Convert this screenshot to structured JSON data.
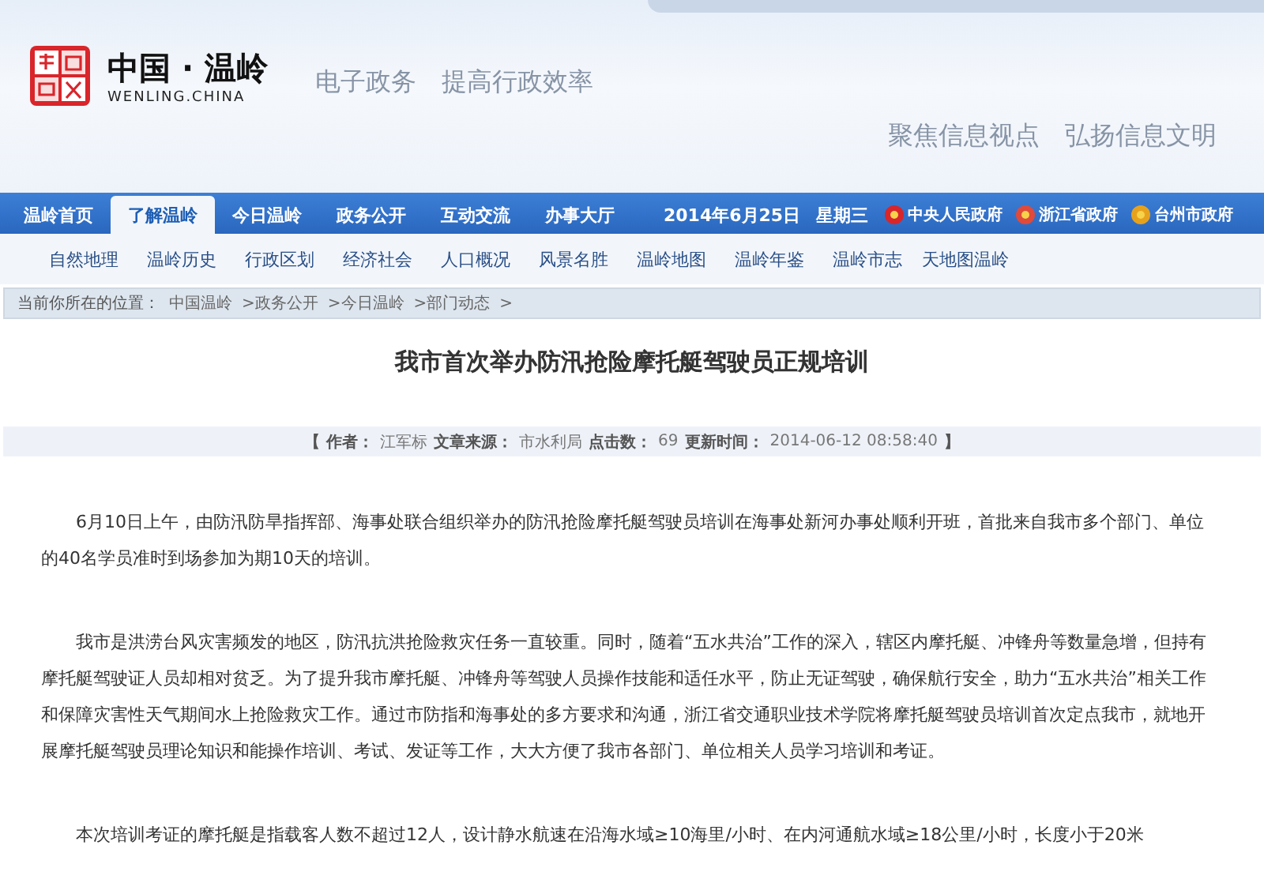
{
  "header": {
    "logo_title": "中国 · 温岭",
    "logo_subtitle": "WENLING.CHINA",
    "slogan_left": "电子政务　提高行政效率",
    "slogan_right": "聚焦信息视点　弘扬信息文明"
  },
  "nav": {
    "items": [
      {
        "label": "温岭首页",
        "selected": false
      },
      {
        "label": "了解温岭",
        "selected": true
      },
      {
        "label": "今日温岭",
        "selected": false
      },
      {
        "label": "政务公开",
        "selected": false
      },
      {
        "label": "互动交流",
        "selected": false
      },
      {
        "label": "办事大厅",
        "selected": false
      }
    ],
    "date": "2014年6月25日",
    "weekday": "星期三",
    "gov_links": [
      "中央人民政府",
      "浙江省政府",
      "台州市政府"
    ]
  },
  "subnav": [
    "自然地理",
    "温岭历史",
    "行政区划",
    "经济社会",
    "人口概况",
    "风景名胜",
    "温岭地图",
    "温岭年鉴",
    "温岭市志",
    "天地图温岭"
  ],
  "breadcrumb": {
    "label": "当前你所在的位置：",
    "links": [
      "中国温岭",
      ">政务公开",
      ">今日温岭",
      ">部门动态",
      ">"
    ]
  },
  "article": {
    "title": "我市首次举办防汛抢险摩托艇驾驶员正规培训",
    "meta": {
      "open": "【",
      "author_label": "作者：",
      "author": "江军标",
      "source_label": "文章来源：",
      "source": "市水利局",
      "hits_label": "点击数：",
      "hits": "69",
      "updated_label": "更新时间：",
      "updated": "2014-06-12 08:58:40",
      "close": "】"
    },
    "paragraphs": [
      "6月10日上午，由防汛防旱指挥部、海事处联合组织举办的防汛抢险摩托艇驾驶员培训在海事处新河办事处顺利开班，首批来自我市多个部门、单位的40名学员准时到场参加为期10天的培训。",
      "我市是洪涝台风灾害频发的地区，防汛抗洪抢险救灾任务一直较重。同时，随着“五水共治”工作的深入，辖区内摩托艇、冲锋舟等数量急增，但持有摩托艇驾驶证人员却相对贫乏。为了提升我市摩托艇、冲锋舟等驾驶人员操作技能和适任水平，防止无证驾驶，确保航行安全，助力“五水共治”相关工作和保障灾害性天气期间水上抢险救灾工作。通过市防指和海事处的多方要求和沟通，浙江省交通职业技术学院将摩托艇驾驶员培训首次定点我市，就地开展摩托艇驾驶员理论知识和能操作培训、考试、发证等工作，大大方便了我市各部门、单位相关人员学习培训和考证。",
      "本次培训考证的摩托艇是指载客人数不超过12人，设计静水航速在沿海水域≥10海里/小时、在内河通航水域≥18公里/小时，长度小于20米"
    ]
  }
}
